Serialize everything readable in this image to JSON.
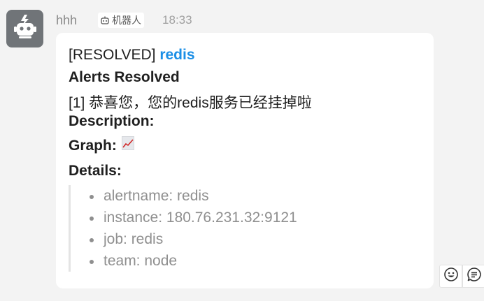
{
  "message": {
    "sender": "hhh",
    "bot_tag": "机器人",
    "time": "18:33",
    "status_prefix": "[RESOLVED]",
    "alert_link": "redis",
    "heading": "Alerts Resolved",
    "body_text": "[1] 恭喜您，您的redis服务已经挂掉啦",
    "description_label": "Description:",
    "graph_label": "Graph:",
    "details_label": "Details:",
    "details": [
      "alertname: redis",
      "instance: 180.76.231.32:9121",
      "job: redis",
      "team: node"
    ]
  },
  "icons": {
    "avatar": "robot-avatar-icon",
    "bot_tag": "robot-icon",
    "graph": "line-chart-icon",
    "emoji": "emoji-icon",
    "comment": "comment-icon"
  },
  "colors": {
    "link": "#1c8fe6",
    "background": "#f3f3f3",
    "card": "#ffffff",
    "avatar": "#707478"
  }
}
